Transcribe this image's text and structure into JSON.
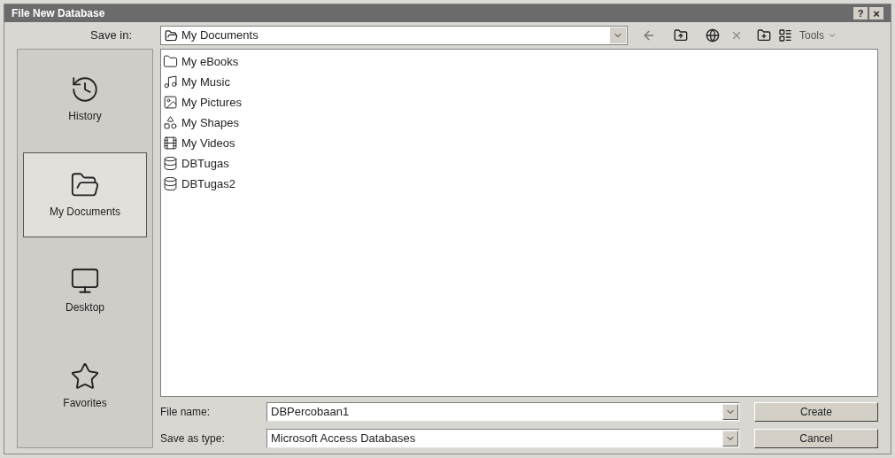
{
  "window": {
    "title": "File New Database",
    "help_button": "?",
    "close_button": "×"
  },
  "toolbar": {
    "save_in_label": "Save in:",
    "location": "My Documents",
    "tools_label": "Tools"
  },
  "places": [
    {
      "label": "History",
      "kind": "history",
      "selected": false
    },
    {
      "label": "My Documents",
      "kind": "documents",
      "selected": true
    },
    {
      "label": "Desktop",
      "kind": "desktop",
      "selected": false
    },
    {
      "label": "Favorites",
      "kind": "favorites",
      "selected": false
    }
  ],
  "files": [
    {
      "name": "My eBooks",
      "kind": "folder"
    },
    {
      "name": "My Music",
      "kind": "music"
    },
    {
      "name": "My Pictures",
      "kind": "pictures"
    },
    {
      "name": "My Shapes",
      "kind": "shapes"
    },
    {
      "name": "My Videos",
      "kind": "videos"
    },
    {
      "name": "DBTugas",
      "kind": "database"
    },
    {
      "name": "DBTugas2",
      "kind": "database"
    }
  ],
  "file_name": {
    "label": "File name:",
    "value": "DBPercobaan1"
  },
  "save_as_type": {
    "label": "Save as type:",
    "value": "Microsoft Access Databases"
  },
  "buttons": [
    "Create",
    "Cancel"
  ]
}
